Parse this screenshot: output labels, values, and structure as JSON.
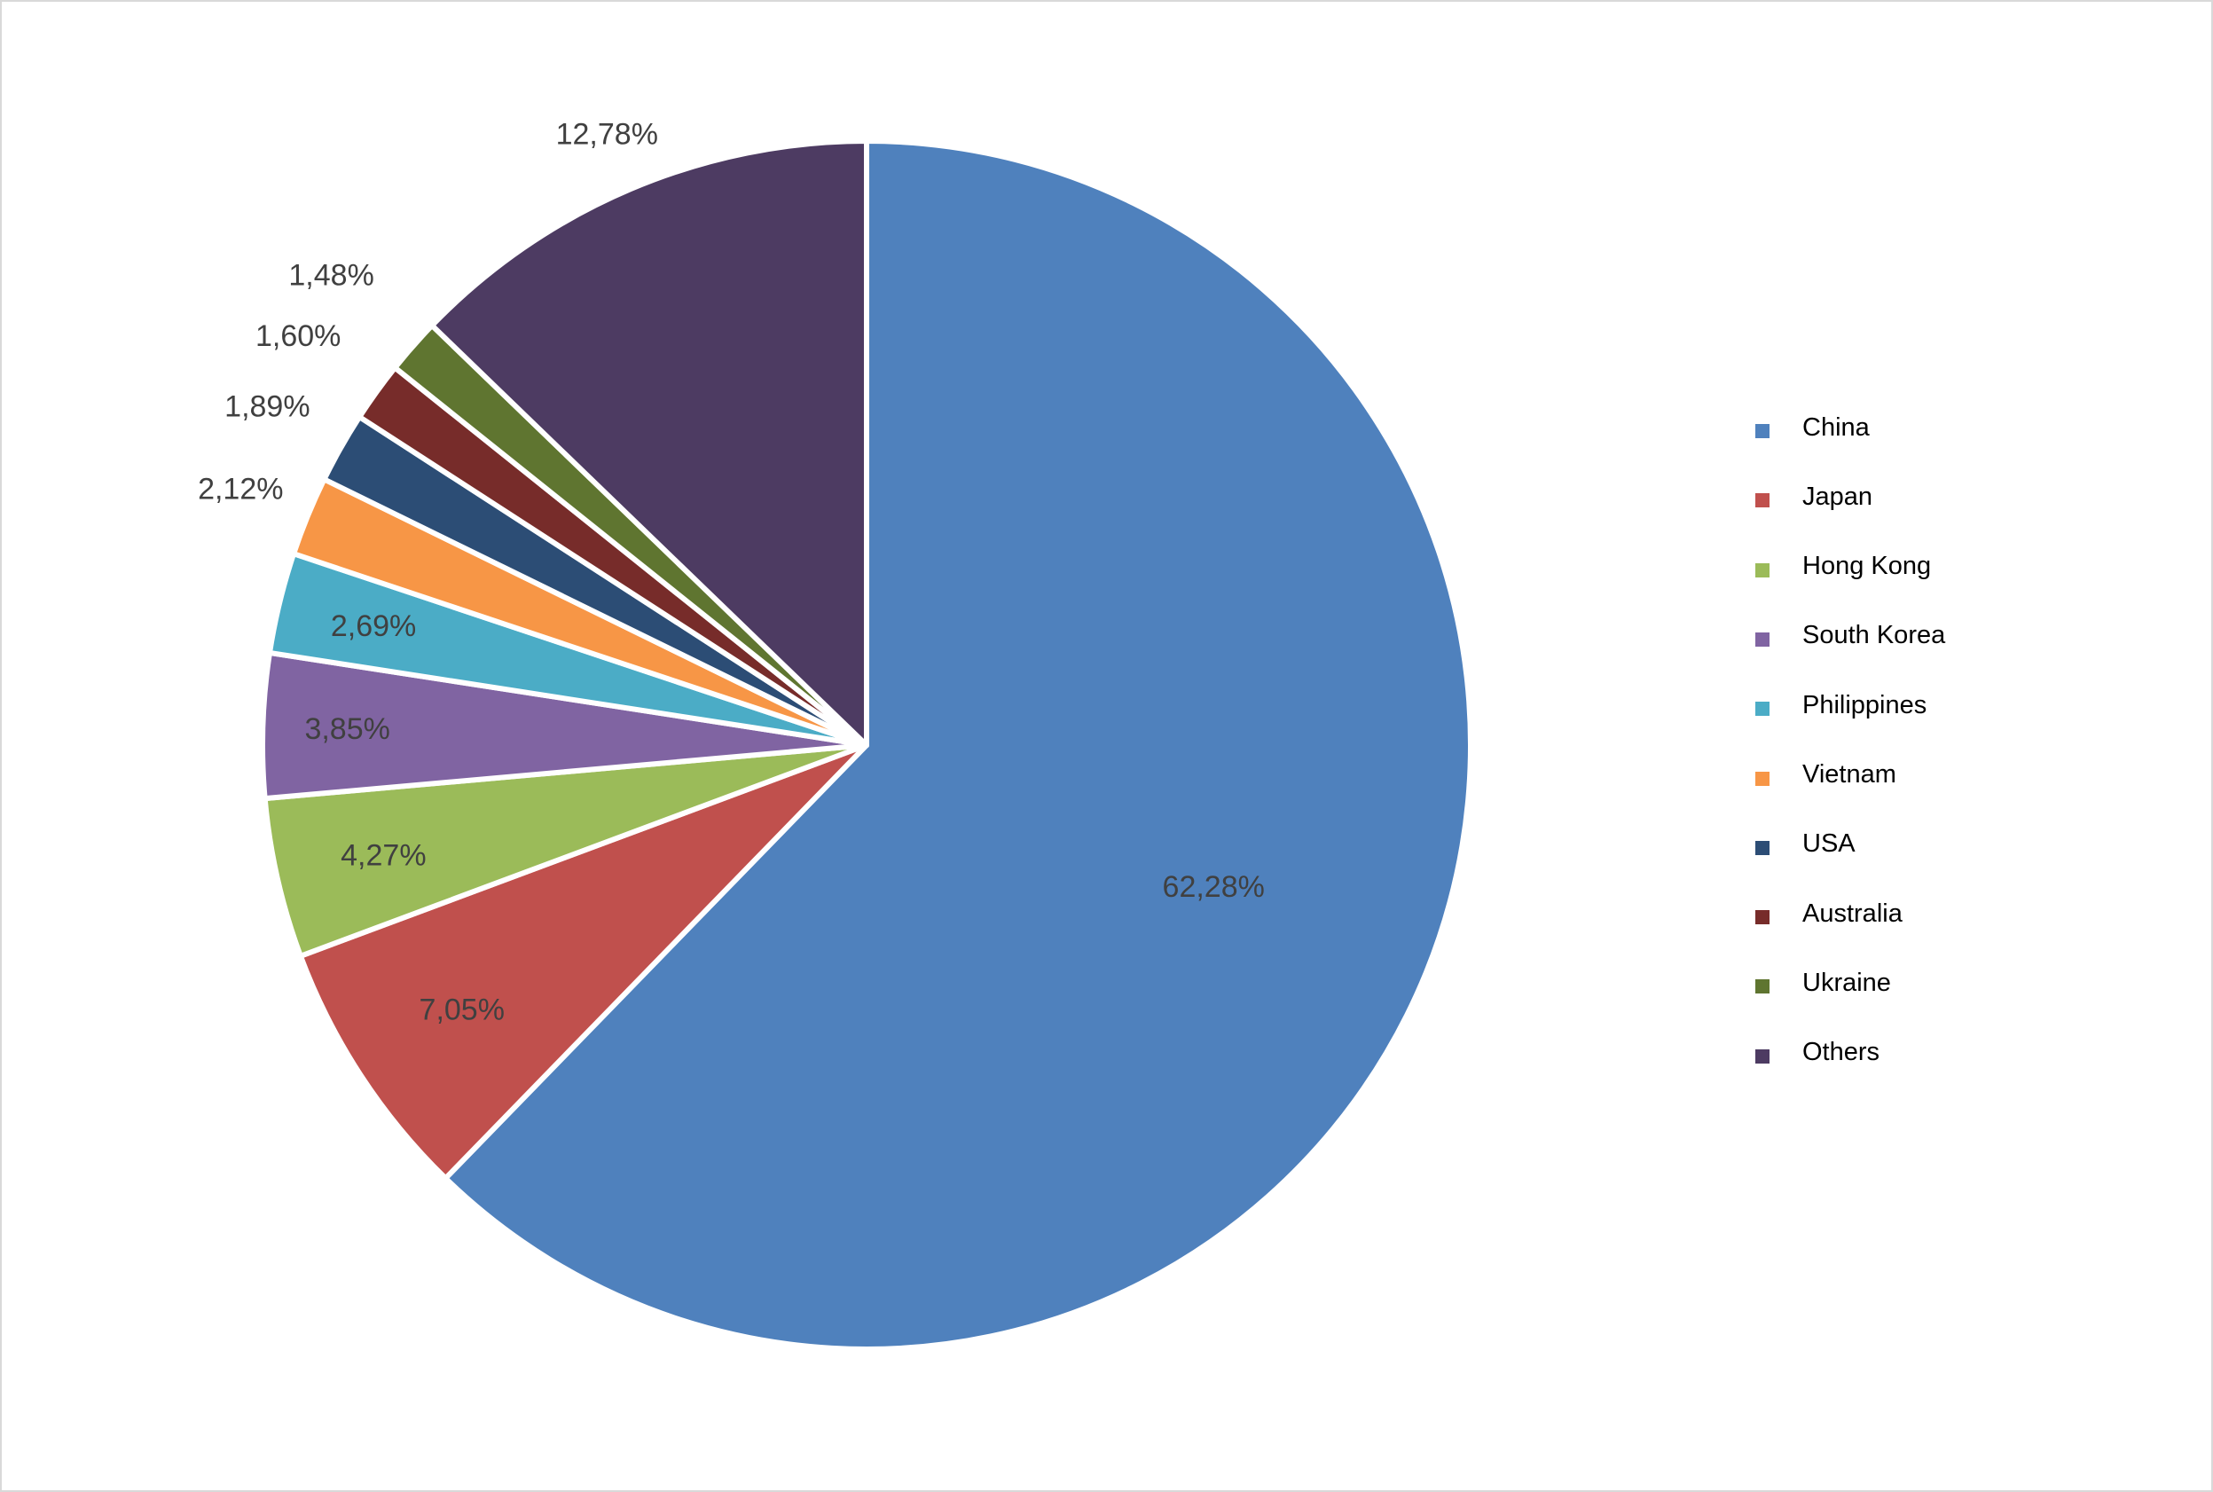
{
  "chart_data": {
    "type": "pie",
    "title": "",
    "start_angle": "12 o'clock",
    "direction": "clockwise",
    "legend_position": "right",
    "categories": [
      "China",
      "Japan",
      "Hong Kong",
      "South Korea",
      "Philippines",
      "Vietnam",
      "USA",
      "Australia",
      "Ukraine",
      "Others"
    ],
    "values": [
      62.28,
      7.05,
      4.27,
      3.85,
      2.69,
      2.12,
      1.89,
      1.6,
      1.48,
      12.78
    ],
    "labels": [
      "62,28%",
      "7,05%",
      "4,27%",
      "3,85%",
      "2,69%",
      "2,12%",
      "1,89%",
      "1,60%",
      "1,48%",
      "12,78%"
    ],
    "colors": [
      "#4F81BD",
      "#C0504D",
      "#9BBB59",
      "#8064A2",
      "#4BACC6",
      "#F79646",
      "#2C4D75",
      "#772C2A",
      "#5F7530",
      "#4D3B62"
    ],
    "label_color": "#404040",
    "units": "percent"
  }
}
